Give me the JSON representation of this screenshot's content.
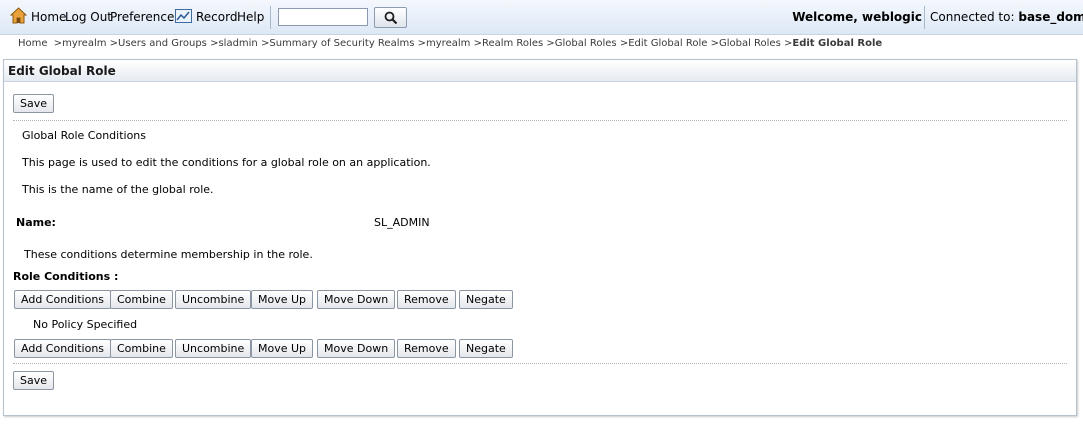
{
  "toolbar": {
    "home": "Home",
    "logout": "Log Out",
    "preferences": "Preferences",
    "record": "Record",
    "help": "Help",
    "search_value": "",
    "welcome": "Welcome, weblogic",
    "connected_label": "Connected to:",
    "connected_domain": "base_domain"
  },
  "breadcrumb": {
    "items": [
      "Home",
      "myrealm",
      "Users and Groups",
      "sladmin",
      "Summary of Security Realms",
      "myrealm",
      "Realm Roles",
      "Global Roles",
      "Edit Global Role",
      "Global Roles"
    ],
    "separator": ">",
    "current": "Edit Global Role"
  },
  "panel": {
    "title": "Edit Global Role",
    "save_label": "Save",
    "section_title": "Global Role Conditions",
    "description": "This page is used to edit the conditions for a global role on an application.",
    "name_help": "This is the name of the global role.",
    "name_label": "Name:",
    "name_value": "SL_ADMIN",
    "conditions_help": "These conditions determine membership in the role.",
    "role_conditions_label": "Role Conditions :",
    "no_policy": "No Policy Specified",
    "actions": {
      "add": "Add Conditions",
      "combine": "Combine",
      "uncombine": "Uncombine",
      "move_up": "Move Up",
      "move_down": "Move Down",
      "remove": "Remove",
      "negate": "Negate"
    }
  },
  "colors": {
    "toolbar_bg": "#dde8f6",
    "panel_border": "#b7c2cf"
  }
}
